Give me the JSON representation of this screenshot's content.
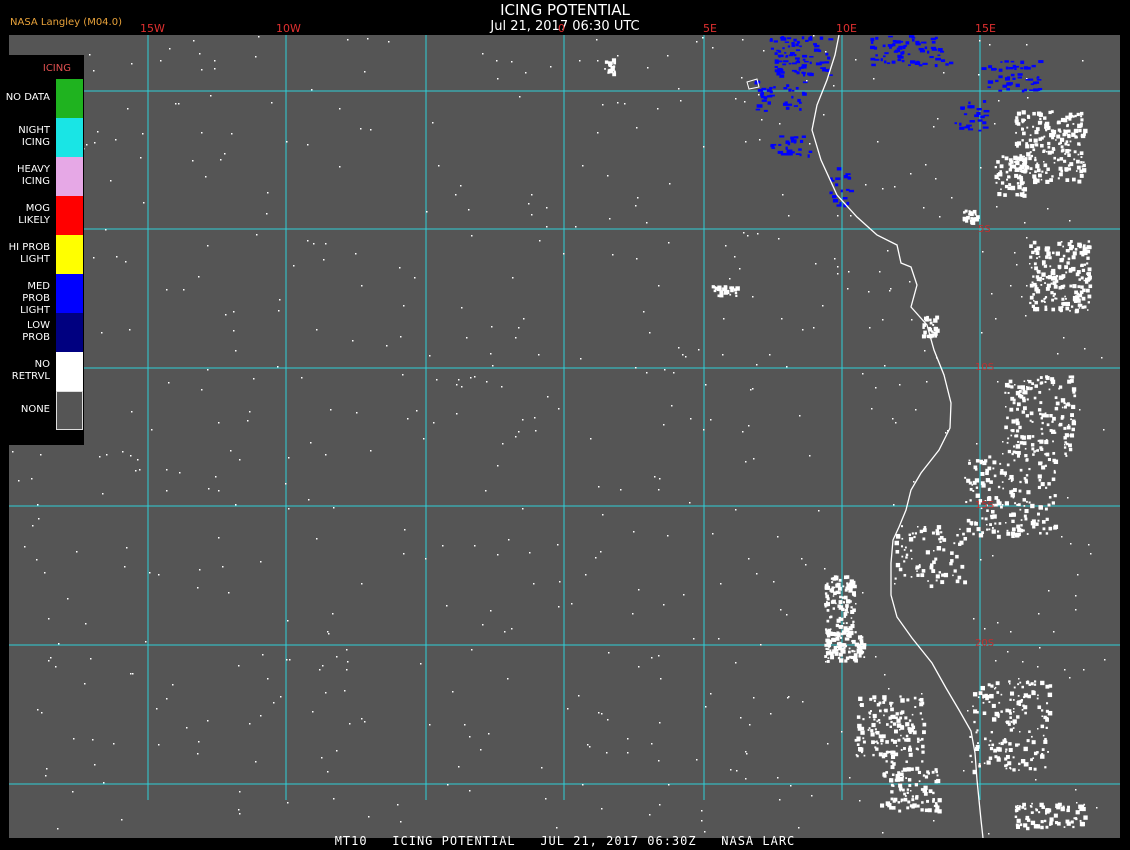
{
  "header": {
    "title": "ICING POTENTIAL",
    "datetime": "Jul 21, 2017 06:30 UTC",
    "credit": "NASA Langley (M04.0)"
  },
  "lon_labels": [
    "15W",
    "10W",
    "0",
    "5E",
    "10E",
    "15E"
  ],
  "lat_labels": [
    "5S",
    "10S",
    "15S",
    "20S"
  ],
  "legend": {
    "title": "ICING",
    "items": [
      {
        "label": "NO DATA",
        "color": "#1fb31f"
      },
      {
        "label": "NIGHT ICING",
        "color": "#19e5e5"
      },
      {
        "label": "HEAVY ICING",
        "color": "#e6a8e6"
      },
      {
        "label": "MOG LIKELY",
        "color": "#ff0000"
      },
      {
        "label": "HI PROB LIGHT",
        "color": "#ffff00"
      },
      {
        "label": "MED PROB LIGHT",
        "color": "#0000ff"
      },
      {
        "label": "LOW PROB",
        "color": "#000080"
      },
      {
        "label": "NO RETRVL",
        "color": "#ffffff"
      },
      {
        "label": "NONE",
        "color": "#555555"
      }
    ]
  },
  "footer": "MT10   ICING POTENTIAL   JUL 21, 2017 06:30Z   NASA LARC",
  "colors": {
    "grid": "#2fd0d8",
    "coast": "#ffffff",
    "background": "#555555"
  }
}
